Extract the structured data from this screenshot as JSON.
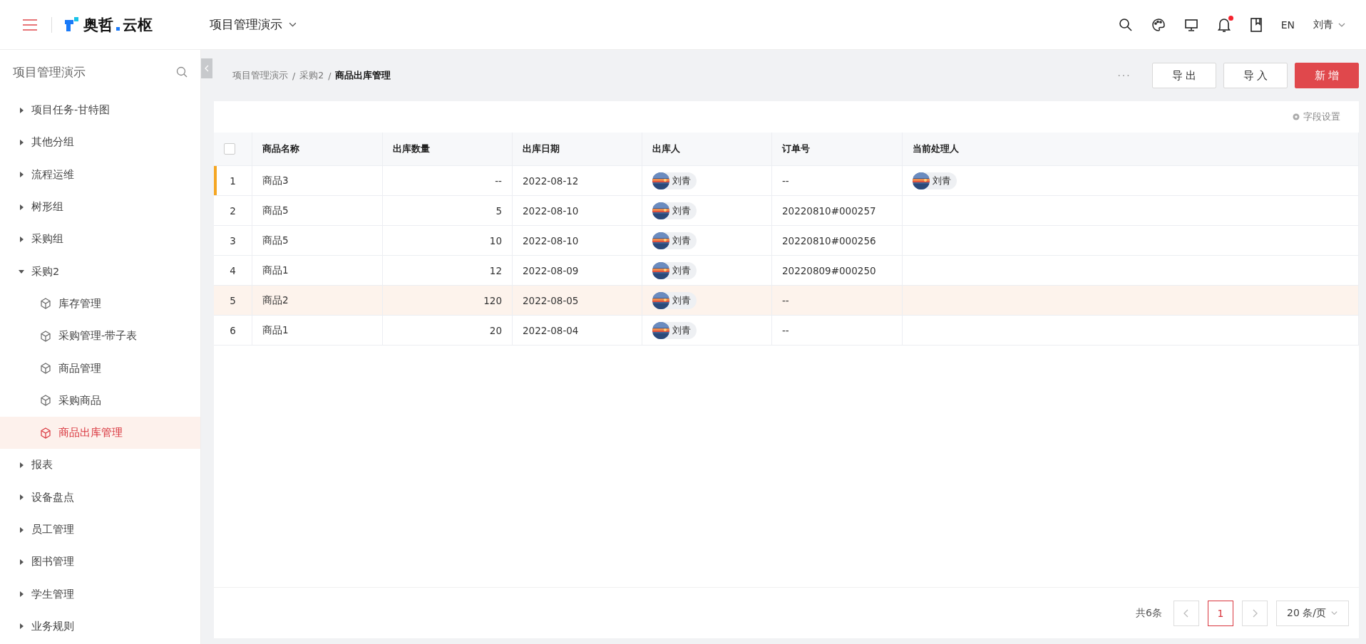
{
  "header": {
    "logo": {
      "part1": "奥哲",
      "part2": "云枢"
    },
    "app_switcher": "项目管理演示",
    "notification_dot": true,
    "language": "EN",
    "user": "刘青"
  },
  "sidebar": {
    "title": "项目管理演示",
    "items": [
      {
        "label": "项目任务-甘特图",
        "expanded": false
      },
      {
        "label": "其他分组",
        "expanded": false
      },
      {
        "label": "流程运维",
        "expanded": false
      },
      {
        "label": "树形组",
        "expanded": false
      },
      {
        "label": "采购组",
        "expanded": false
      },
      {
        "label": "采购2",
        "expanded": true,
        "children": [
          {
            "label": "库存管理",
            "selected": false
          },
          {
            "label": "采购管理-带子表",
            "selected": false
          },
          {
            "label": "商品管理",
            "selected": false
          },
          {
            "label": "采购商品",
            "selected": false
          },
          {
            "label": "商品出库管理",
            "selected": true
          }
        ]
      },
      {
        "label": "报表",
        "expanded": false
      },
      {
        "label": "设备盘点",
        "expanded": false
      },
      {
        "label": "员工管理",
        "expanded": false
      },
      {
        "label": "图书管理",
        "expanded": false
      },
      {
        "label": "学生管理",
        "expanded": false
      },
      {
        "label": "业务规则",
        "expanded": false
      }
    ]
  },
  "breadcrumb": [
    "项目管理演示",
    "采购2",
    "商品出库管理"
  ],
  "breadcrumb_separator": "/",
  "toolbar": {
    "more": "···",
    "buttons": [
      {
        "label": "导 出",
        "kind": "default"
      },
      {
        "label": "导 入",
        "kind": "default"
      },
      {
        "label": "新 增",
        "kind": "primary"
      }
    ]
  },
  "table": {
    "field_settings": "字段设置",
    "select_all_checked": false,
    "columns": [
      "商品名称",
      "出库数量",
      "出库日期",
      "出库人",
      "订单号",
      "当前处理人"
    ],
    "rows": [
      {
        "index": "1",
        "name": "商品3",
        "quantity": "--",
        "date": "2022-08-12",
        "issuer": "刘青",
        "order": "--",
        "handler": "刘青",
        "current": true,
        "hovered": false
      },
      {
        "index": "2",
        "name": "商品5",
        "quantity": "5",
        "date": "2022-08-10",
        "issuer": "刘青",
        "order": "20220810#000257",
        "current": false,
        "hovered": false
      },
      {
        "index": "3",
        "name": "商品5",
        "quantity": "10",
        "date": "2022-08-10",
        "issuer": "刘青",
        "order": "20220810#000256",
        "current": false,
        "hovered": false
      },
      {
        "index": "4",
        "name": "商品1",
        "quantity": "12",
        "date": "2022-08-09",
        "issuer": "刘青",
        "order": "20220809#000250",
        "current": false,
        "hovered": false
      },
      {
        "index": "5",
        "name": "商品2",
        "quantity": "120",
        "date": "2022-08-05",
        "issuer": "刘青",
        "order": "--",
        "current": false,
        "hovered": true
      },
      {
        "index": "6",
        "name": "商品1",
        "quantity": "20",
        "date": "2022-08-04",
        "issuer": "刘青",
        "order": "--",
        "current": false,
        "hovered": false
      }
    ]
  },
  "pagination": {
    "total": "共6条",
    "pages": [
      {
        "label": "1",
        "selected": true
      }
    ],
    "page_size": "20 条/页"
  }
}
